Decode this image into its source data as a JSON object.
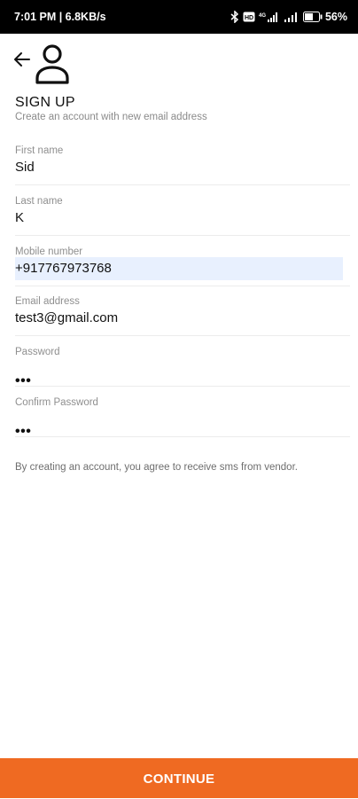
{
  "status_bar": {
    "time_speed": "7:01 PM | 6.8KB/s",
    "network_label": "4G",
    "battery_percent": "56"
  },
  "header": {
    "back_icon": "arrow-left-icon",
    "avatar_icon": "person-icon"
  },
  "page": {
    "title": "SIGN UP",
    "subtitle": "Create an account with new email address"
  },
  "form": {
    "first_name": {
      "label": "First name",
      "value": "Sid"
    },
    "last_name": {
      "label": "Last name",
      "value": "K"
    },
    "mobile": {
      "label": "Mobile number",
      "value": "+917767973768"
    },
    "email": {
      "label": "Email address",
      "value": "test3@gmail.com"
    },
    "password": {
      "label": "Password",
      "value": "•••"
    },
    "confirm_password": {
      "label": "Confirm Password",
      "value": "•••"
    }
  },
  "consent_text": "By creating an account, you agree to receive sms from vendor.",
  "continue_label": "CONTINUE",
  "colors": {
    "accent": "#ef6a22",
    "autofill": "#e8f0fe"
  }
}
